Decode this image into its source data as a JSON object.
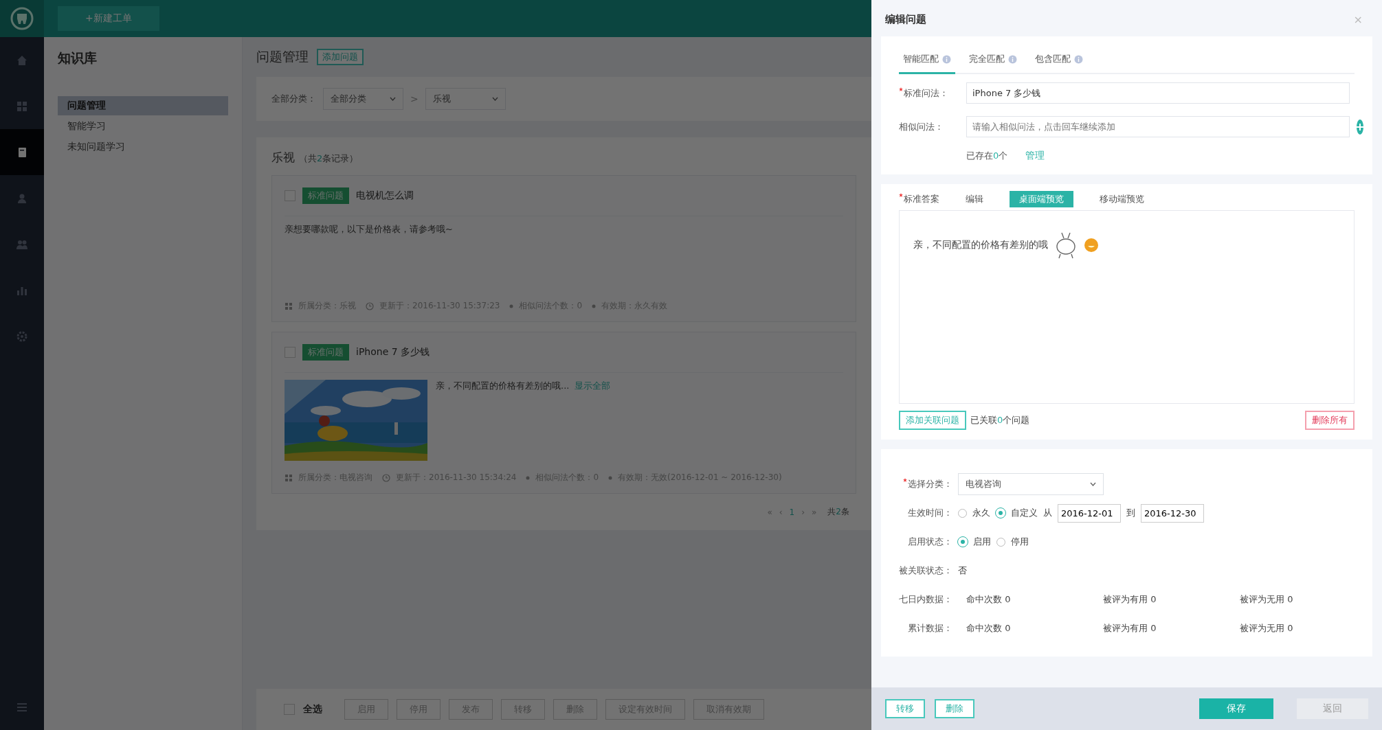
{
  "top_bar": {
    "new_ticket_button": "+新建工单"
  },
  "nav_rail": {
    "items": [
      {
        "kind": "home",
        "selected": false
      },
      {
        "kind": "grid",
        "selected": false
      },
      {
        "kind": "book",
        "selected": true
      },
      {
        "kind": "person",
        "selected": false
      },
      {
        "kind": "group",
        "selected": false
      },
      {
        "kind": "chart",
        "selected": false
      },
      {
        "kind": "gear",
        "selected": false
      }
    ],
    "bottom": {
      "kind": "menu"
    }
  },
  "sidebar": {
    "title": "知识库",
    "items": [
      {
        "label": "问题管理",
        "selected": true
      },
      {
        "label": "智能学习",
        "selected": false
      },
      {
        "label": "未知问题学习",
        "selected": false
      }
    ]
  },
  "page": {
    "title": "问题管理",
    "add_button": "添加问题"
  },
  "filter": {
    "label": "全部分类：",
    "selects": [
      "全部分类",
      "乐视"
    ],
    "separator": ">"
  },
  "list": {
    "title": "乐视",
    "count_prefix": "（共",
    "count": "2",
    "count_suffix": "条记录）",
    "cards": [
      {
        "checked": false,
        "tag": "标准问题",
        "title": "电视机怎么调",
        "body": "亲想要哪款呢，以下是价格表，请参考哦~",
        "meta": [
          {
            "kind": "category",
            "text": "所属分类：乐视"
          },
          {
            "kind": "time",
            "text": "更新于：2016-11-30 15:37:23"
          },
          {
            "kind": "dot",
            "text": "相似问法个数：0"
          },
          {
            "kind": "dot",
            "text": "有效期：永久有效"
          }
        ]
      },
      {
        "checked": false,
        "tag": "标准问题",
        "title": "iPhone 7 多少钱",
        "picture": {
          "kind": "picture"
        },
        "body": "亲，不同配置的价格有差别的哦...",
        "link": "显示全部",
        "meta": [
          {
            "kind": "category",
            "text": "所属分类：电视咨询"
          },
          {
            "kind": "time",
            "text": "更新于：2016-11-30 15:34:24"
          },
          {
            "kind": "dot",
            "text": "相似问法个数：0"
          },
          {
            "kind": "dot",
            "text": "有效期：无效(2016-12-01 ~ 2016-12-30)"
          }
        ]
      }
    ],
    "pagination": {
      "controls": [
        {
          "label": "«",
          "selected": false
        },
        {
          "label": "‹",
          "selected": false
        },
        {
          "label": "1",
          "selected": true
        },
        {
          "label": "›",
          "selected": false
        },
        {
          "label": "»",
          "selected": false
        }
      ],
      "total_prefix": "共",
      "total_count": "2",
      "total_suffix": "条"
    }
  },
  "bulk_bar": {
    "select_all": {
      "label": "全选",
      "checked": false
    },
    "buttons": [
      "启用",
      "停用",
      "发布",
      "转移",
      "删除",
      "设定有效时间",
      "取消有效期"
    ]
  },
  "editor": {
    "title": "编辑问题",
    "close": "×",
    "match_tabs": [
      {
        "label": "智能匹配",
        "selected": true
      },
      {
        "label": "完全匹配",
        "selected": false
      },
      {
        "label": "包含匹配",
        "selected": false
      }
    ],
    "standard_question": {
      "label": "标准问法：",
      "required": true,
      "value": "iPhone 7 多少钱"
    },
    "similar_question": {
      "label": "相似问法：",
      "required": false,
      "placeholder": "请输入相似问法，点击回车继续添加"
    },
    "similar_count": {
      "prefix": "已存在",
      "count": "0",
      "suffix": "个",
      "manage_link": "管理"
    },
    "answer": {
      "label": "标准答案",
      "required": true,
      "tabs": [
        {
          "label": "编辑",
          "selected": false
        },
        {
          "label": "桌面端预览",
          "selected": true
        },
        {
          "label": "移动端预览",
          "selected": false
        }
      ],
      "text": "亲，不同配置的价格有差别的哦",
      "emojis": [
        {
          "kind": "sketch"
        },
        {
          "kind": "round"
        }
      ]
    },
    "related": {
      "add_button": "添加关联问题",
      "prefix": "已关联",
      "count": "0",
      "suffix": "个问题",
      "delete_all_button": "删除所有"
    },
    "category": {
      "label": "选择分类：",
      "required": true,
      "value": "电视咨询"
    },
    "effective_time": {
      "label": "生效时间：",
      "options": [
        {
          "label": "永久",
          "selected": false
        },
        {
          "label": "自定义",
          "selected": true
        }
      ],
      "from_label": "从",
      "from": "2016-12-01",
      "to_label": "到",
      "to": "2016-12-30"
    },
    "enable_state": {
      "label": "启用状态：",
      "options": [
        {
          "label": "启用",
          "selected": true
        },
        {
          "label": "停用",
          "selected": false
        }
      ]
    },
    "linked_state": {
      "label": "被关联状态：",
      "value": "否"
    },
    "stats": [
      {
        "label": "七日内数据：",
        "cells": [
          "命中次数 0",
          "被评为有用 0",
          "被评为无用 0"
        ]
      },
      {
        "label": "累计数据：",
        "cells": [
          "命中次数 0",
          "被评为有用 0",
          "被评为无用 0"
        ]
      }
    ],
    "footer": {
      "left_buttons": [
        "转移",
        "删除"
      ],
      "save_button": "保存",
      "back_button": "返回"
    }
  }
}
